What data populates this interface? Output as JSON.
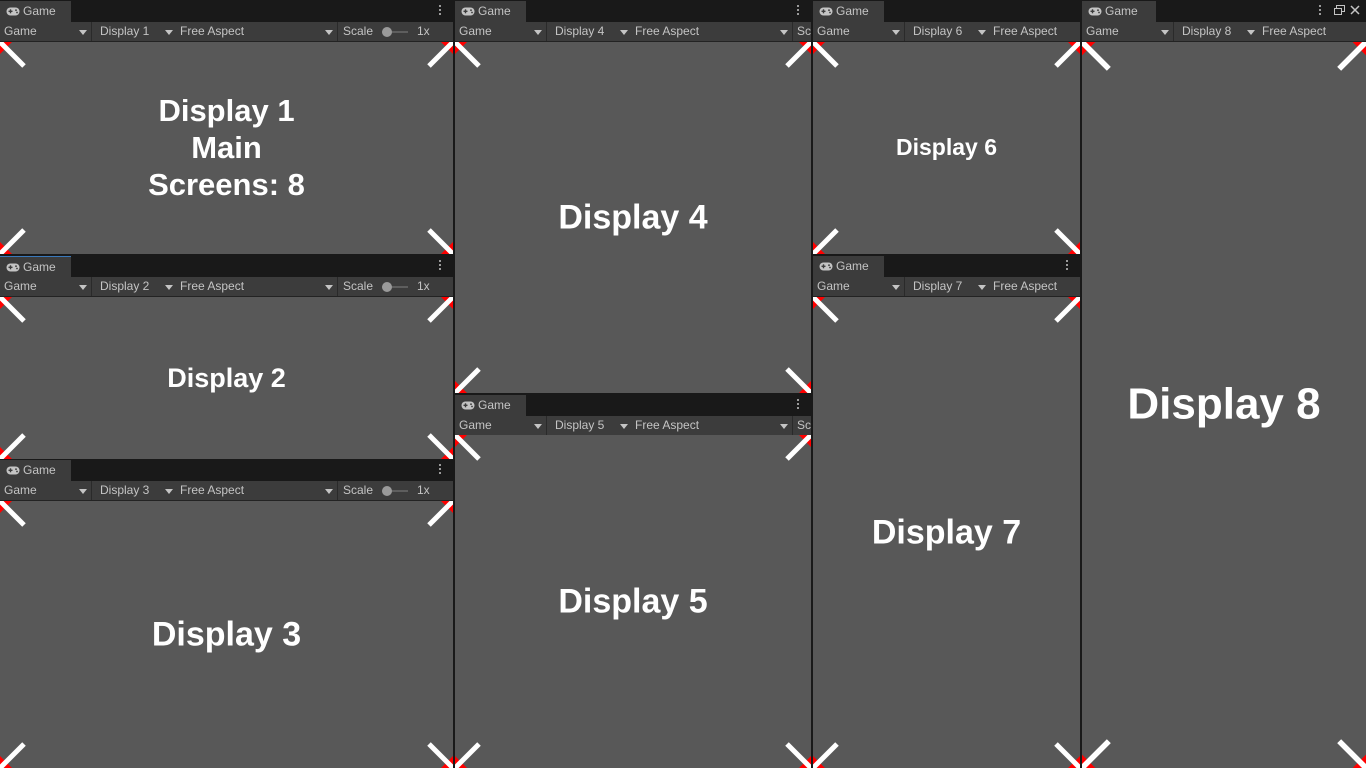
{
  "panels": [
    {
      "tab": "Game",
      "toolbar": {
        "mode": "Game",
        "display": "Display 1",
        "aspect": "Free Aspect",
        "scale_label": "Scale",
        "scale_value": "1x"
      },
      "lines": [
        "Display 1",
        "Main",
        "Screens: 8"
      ]
    },
    {
      "tab": "Game",
      "toolbar": {
        "mode": "Game",
        "display": "Display 2",
        "aspect": "Free Aspect",
        "scale_label": "Scale",
        "scale_value": "1x"
      },
      "lines": [
        "Display 2"
      ]
    },
    {
      "tab": "Game",
      "toolbar": {
        "mode": "Game",
        "display": "Display 3",
        "aspect": "Free Aspect",
        "scale_label": "Scale",
        "scale_value": "1x"
      },
      "lines": [
        "Display 3"
      ]
    },
    {
      "tab": "Game",
      "toolbar": {
        "mode": "Game",
        "display": "Display 4",
        "aspect": "Free Aspect",
        "scale_label": "Sc"
      },
      "lines": [
        "Display 4"
      ]
    },
    {
      "tab": "Game",
      "toolbar": {
        "mode": "Game",
        "display": "Display 5",
        "aspect": "Free Aspect",
        "scale_label": "Sc"
      },
      "lines": [
        "Display 5"
      ]
    },
    {
      "tab": "Game",
      "toolbar": {
        "mode": "Game",
        "display": "Display 6",
        "aspect": "Free Aspect"
      },
      "lines": [
        "Display 6"
      ]
    },
    {
      "tab": "Game",
      "toolbar": {
        "mode": "Game",
        "display": "Display 7",
        "aspect": "Free Aspect"
      },
      "lines": [
        "Display 7"
      ]
    },
    {
      "tab": "Game",
      "toolbar": {
        "mode": "Game",
        "display": "Display 8",
        "aspect": "Free Aspect"
      },
      "lines": [
        "Display 8"
      ]
    }
  ],
  "icons": {
    "tab": "gamepad-icon",
    "menu": "kebab-menu-icon",
    "maximize": "maximize-icon",
    "close": "close-icon"
  },
  "colors": {
    "background": "#585858",
    "corner_red": "#ff0000",
    "corner_white": "#ffffff",
    "toolbar": "#3c3c3c"
  }
}
